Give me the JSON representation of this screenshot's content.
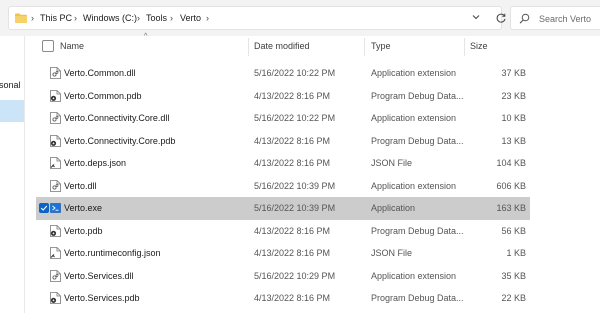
{
  "address": {
    "crumbs": [
      "This PC",
      "Windows (C:)",
      "Tools",
      "Verto"
    ]
  },
  "search": {
    "placeholder": "Search Verto"
  },
  "nav": {
    "partial_label": "rsonal"
  },
  "columns": {
    "name": "Name",
    "date": "Date modified",
    "type": "Type",
    "size": "Size"
  },
  "files": [
    {
      "name": "Verto.Common.dll",
      "date": "5/16/2022 10:22 PM",
      "type": "Application extension",
      "size": "37 KB",
      "icon": "dll-icon"
    },
    {
      "name": "Verto.Common.pdb",
      "date": "4/13/2022 8:16 PM",
      "type": "Program Debug Data...",
      "size": "23 KB",
      "icon": "pdb-icon"
    },
    {
      "name": "Verto.Connectivity.Core.dll",
      "date": "5/16/2022 10:22 PM",
      "type": "Application extension",
      "size": "10 KB",
      "icon": "dll-icon"
    },
    {
      "name": "Verto.Connectivity.Core.pdb",
      "date": "4/13/2022 8:16 PM",
      "type": "Program Debug Data...",
      "size": "13 KB",
      "icon": "pdb-icon"
    },
    {
      "name": "Verto.deps.json",
      "date": "4/13/2022 8:16 PM",
      "type": "JSON File",
      "size": "104 KB",
      "icon": "json-icon"
    },
    {
      "name": "Verto.dll",
      "date": "5/16/2022 10:39 PM",
      "type": "Application extension",
      "size": "606 KB",
      "icon": "dll-icon"
    },
    {
      "name": "Verto.exe",
      "date": "5/16/2022 10:39 PM",
      "type": "Application",
      "size": "163 KB",
      "icon": "exe-icon",
      "selected": true
    },
    {
      "name": "Verto.pdb",
      "date": "4/13/2022 8:16 PM",
      "type": "Program Debug Data...",
      "size": "56 KB",
      "icon": "pdb-icon"
    },
    {
      "name": "Verto.runtimeconfig.json",
      "date": "4/13/2022 8:16 PM",
      "type": "JSON File",
      "size": "1 KB",
      "icon": "json-icon"
    },
    {
      "name": "Verto.Services.dll",
      "date": "5/16/2022 10:29 PM",
      "type": "Application extension",
      "size": "35 KB",
      "icon": "dll-icon"
    },
    {
      "name": "Verto.Services.pdb",
      "date": "4/13/2022 8:16 PM",
      "type": "Program Debug Data...",
      "size": "22 KB",
      "icon": "pdb-icon"
    }
  ],
  "colors": {
    "selection": "#cccccc",
    "checkbox": "#0a64c8",
    "nav_selected": "#cce4f7"
  }
}
